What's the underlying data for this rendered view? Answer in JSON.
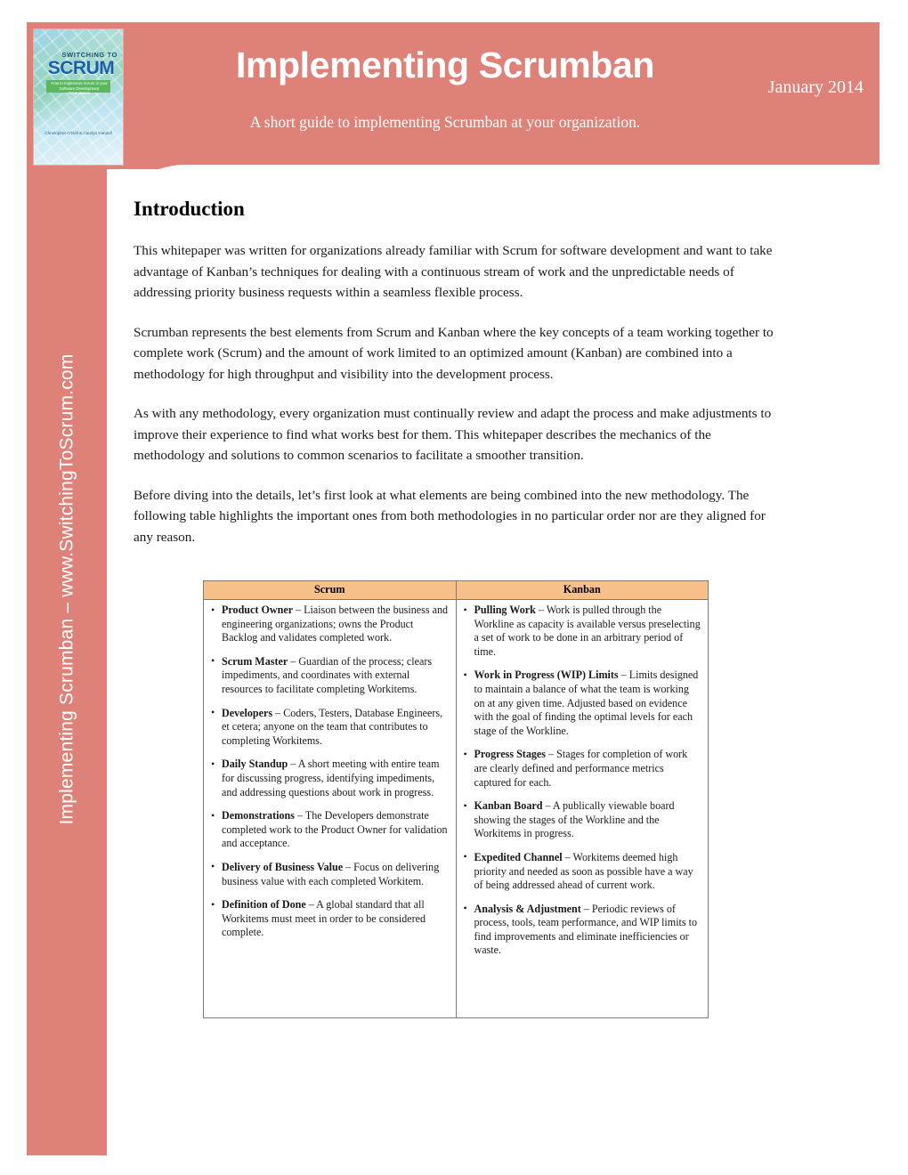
{
  "header": {
    "title": "Implementing Scrumban",
    "date": "January 2014",
    "subtitle": "A short guide to implementing Scrumban at your organization.",
    "band_color": "#DD8179"
  },
  "book_cover": {
    "eyebrow": "SWITCHING TO",
    "title": "SCRUM",
    "subtitle": "How to Implement Scrum in your Software Development Organization",
    "author": "Christopher O'Dell & Carolyn Kandell",
    "bar_color": "#5CB85C"
  },
  "sidebar": {
    "vertical_text": "Implementing Scrumban  –  www.SwitchingToScrum.com"
  },
  "main": {
    "section_title": "Introduction",
    "paragraphs": [
      "This whitepaper was written for organizations already familiar with Scrum for software development and want to take advantage of Kanban’s techniques for dealing with a continuous stream of work and the unpredictable needs of addressing priority business requests within a seamless flexible process.",
      "Scrumban represents the best elements from Scrum and Kanban where the key concepts of a team working together to complete work (Scrum) and the amount of work limited to an optimized amount (Kanban) are combined into a methodology for high throughput and visibility into the development process.",
      "As with any methodology, every organization must continually review and adapt the process and make adjustments to improve their experience to find what works best for them. This whitepaper describes the mechanics of the methodology and solutions to common scenarios to facilitate a smoother transition.",
      "Before diving into the details, let’s first look at what elements are being combined into the new methodology. The following table highlights the important ones from both methodologies in no particular order nor are they aligned for any reason."
    ]
  },
  "comparison_table": {
    "header_fill": "#F7C08B",
    "columns": [
      {
        "header": "Scrum",
        "items": [
          {
            "term": "Product Owner",
            "dash": " – ",
            "text": "Liaison between the business and engineering organizations; owns the Product Backlog and validates completed work."
          },
          {
            "term": "Scrum Master",
            "dash": " – ",
            "text": "Guardian of the process; clears impediments, and coordinates with external resources to facilitate completing Workitems."
          },
          {
            "term": "Developers",
            "dash": " – ",
            "text": "Coders, Testers, Database Engineers, et cetera; anyone on the team that contributes to completing Workitems."
          },
          {
            "term": "Daily Standup",
            "dash": " – ",
            "text": "A short meeting with entire team for discussing progress, identifying impediments, and addressing questions about work in progress."
          },
          {
            "term": "Demonstrations",
            "dash": " – ",
            "text": "The Developers demonstrate completed work to the Product Owner for validation and acceptance."
          },
          {
            "term": "Delivery of Business Value",
            "dash": " – ",
            "text": "Focus on delivering business value with each completed Workitem."
          },
          {
            "term": "Definition of Done",
            "dash": " – ",
            "text": "A global standard that all Workitems must meet in order to be considered complete."
          }
        ]
      },
      {
        "header": "Kanban",
        "items": [
          {
            "term": "Pulling Work",
            "dash": " – ",
            "text": "Work is pulled through the Workline as capacity is available versus preselecting a set of work to be done in an arbitrary period of time."
          },
          {
            "term": "Work in Progress (WIP) Limits",
            "dash": " – ",
            "text": "Limits designed to maintain a balance of what the team is working on at any given time. Adjusted based on evidence with the goal of finding the optimal levels for each stage of the Workline."
          },
          {
            "term": "Progress Stages",
            "dash": " – ",
            "text": "Stages for completion of work are clearly defined and performance metrics captured for each."
          },
          {
            "term": "Kanban Board",
            "dash": " – ",
            "text": "A publically viewable board showing the stages of the Workline and the Workitems in progress."
          },
          {
            "term": "Expedited Channel",
            "dash": " – ",
            "text": "Workitems deemed high priority and needed as soon as possible have a way of being addressed ahead of current work."
          },
          {
            "term": "Analysis & Adjustment",
            "dash": " – ",
            "text": "Periodic reviews of process, tools, team performance, and WIP limits to find improvements and eliminate inefficiencies or waste."
          }
        ]
      }
    ]
  }
}
